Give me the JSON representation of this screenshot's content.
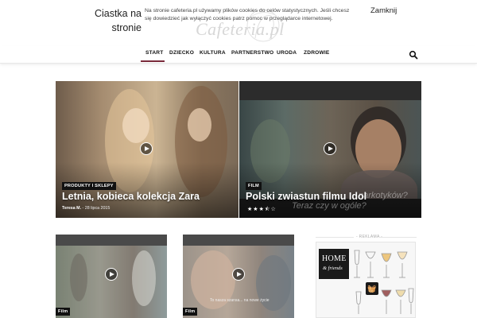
{
  "cookie_bar": {
    "title": "Ciastka na stronie",
    "text": "Na stronie cafeteria.pl używamy plików cookies do celów statystycznych. Jeśli chcesz się dowiedzieć jak wyłączyć cookies patrz pomoc w przeglądarce internetowej.",
    "close_label": "Zamknij"
  },
  "logo": {
    "text": "Cafeteria.pl"
  },
  "nav": {
    "items": [
      {
        "label": "START",
        "active": true
      },
      {
        "label": "DZIECKO"
      },
      {
        "label": "KULTURA"
      },
      {
        "label": "PARTNERSTWO"
      },
      {
        "label": "URODA"
      },
      {
        "label": "ZDROWIE"
      }
    ],
    "search_icon": "search-icon",
    "accent_color": "#7a2a3b"
  },
  "hero": [
    {
      "category": "PRODUKTY I SKLEPY",
      "title": "Letnia, kobieca kolekcja Zara",
      "author": "Teresa M.",
      "date": "28 lipca 2015",
      "icon": "play-icon"
    },
    {
      "category": "FILM",
      "title": "Polski zwiastun filmu Idol",
      "overlay_1": "narkotyków?",
      "overlay_2": "Teraz czy w ogóle?",
      "rating": 3.5,
      "rating_max": 5,
      "icon": "play-icon"
    }
  ],
  "small_tiles": [
    {
      "category": "Film",
      "icon": "play-icon"
    },
    {
      "category": "Film",
      "icon": "play-icon",
      "subtitle": "To nasza szansa... na nowe życie"
    }
  ],
  "ad": {
    "label": "- REKLAMA -",
    "brand_line1": "HOME",
    "brand_line2": "& friends",
    "basket_icon": "basket-icon"
  }
}
